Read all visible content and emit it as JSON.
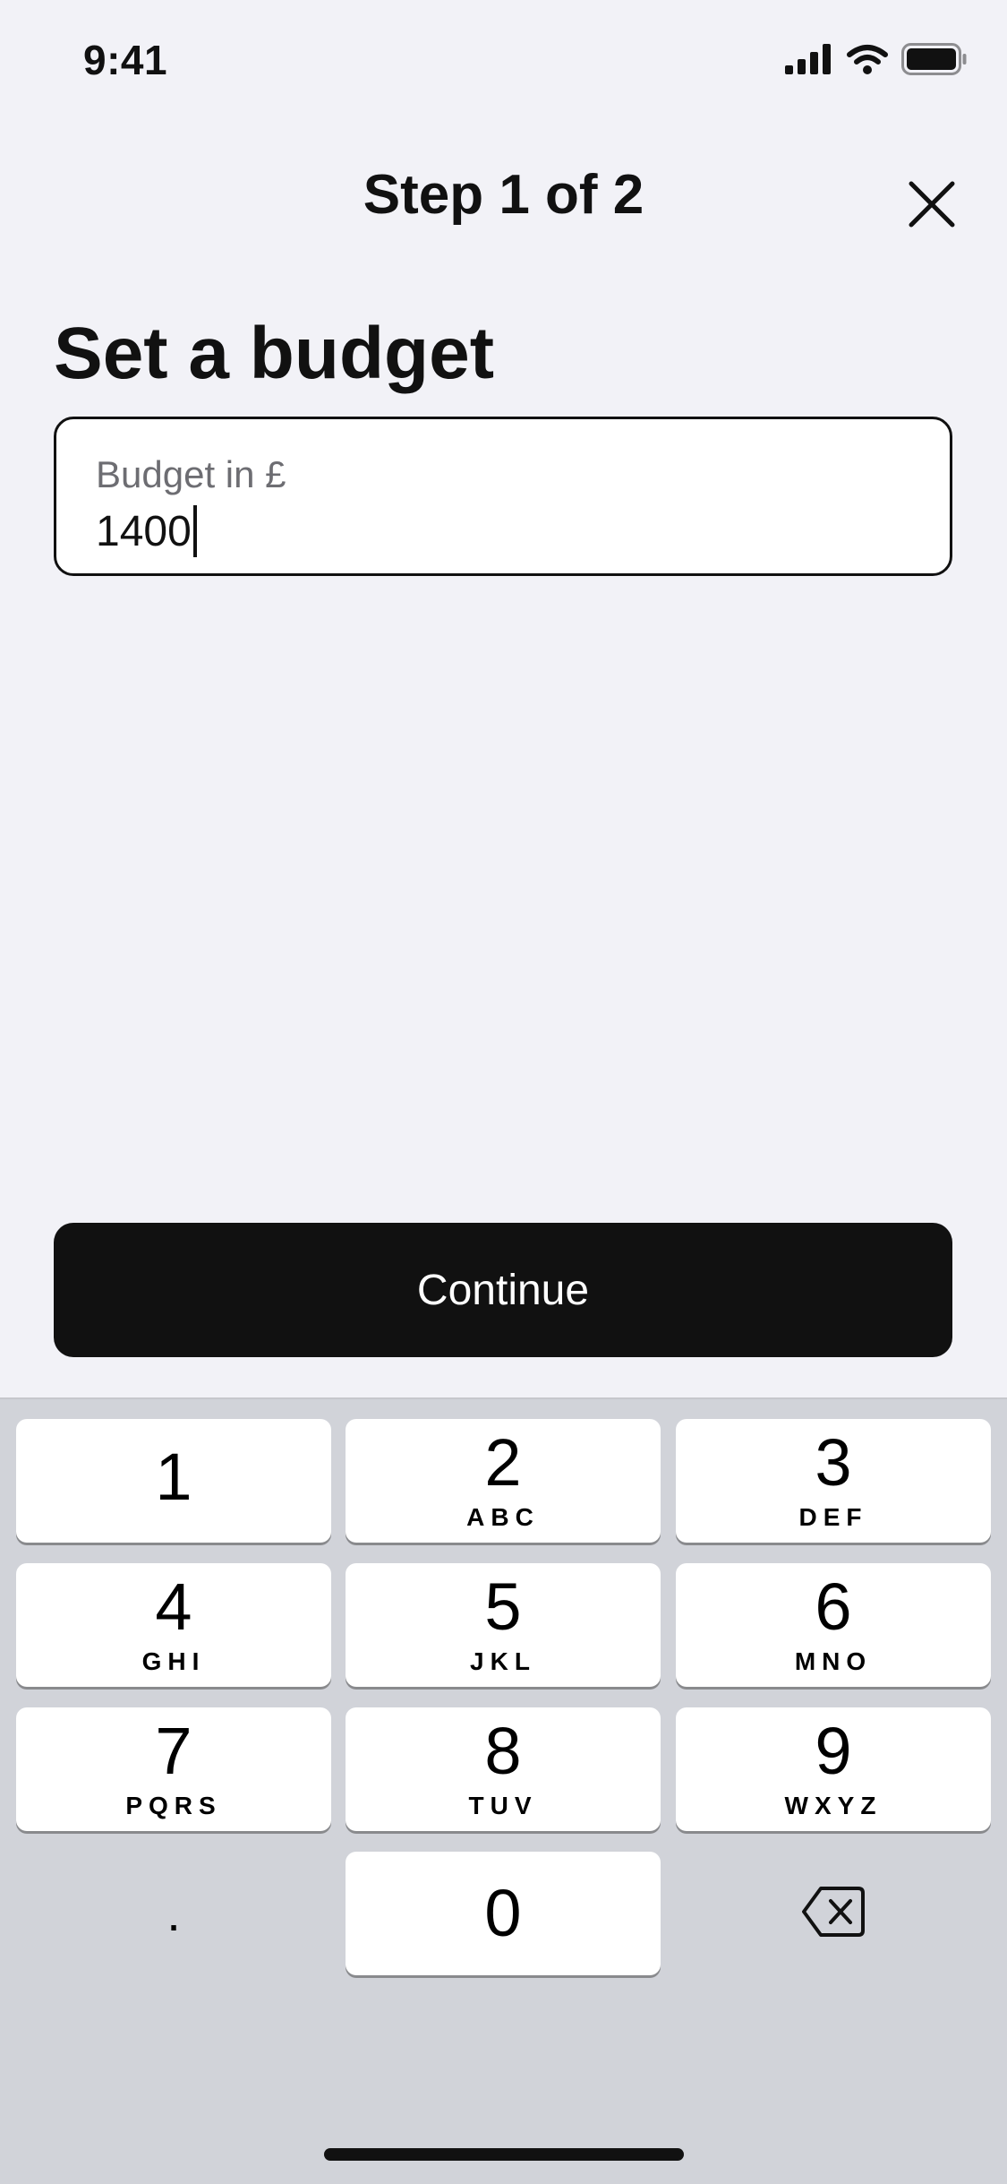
{
  "status_bar": {
    "time": "9:41",
    "icons": [
      "cellular-signal-icon",
      "wifi-icon",
      "battery-icon"
    ]
  },
  "nav": {
    "title": "Step 1 of 2",
    "close_icon": "close-icon"
  },
  "page": {
    "title": "Set a budget"
  },
  "budget_field": {
    "label": "Budget in £",
    "value": "1400"
  },
  "continue_button": {
    "label": "Continue"
  },
  "keypad": {
    "keys": [
      {
        "digit": "1",
        "letters": ""
      },
      {
        "digit": "2",
        "letters": "ABC"
      },
      {
        "digit": "3",
        "letters": "DEF"
      },
      {
        "digit": "4",
        "letters": "GHI"
      },
      {
        "digit": "5",
        "letters": "JKL"
      },
      {
        "digit": "6",
        "letters": "MNO"
      },
      {
        "digit": "7",
        "letters": "PQRS"
      },
      {
        "digit": "8",
        "letters": "TUV"
      },
      {
        "digit": "9",
        "letters": "WXYZ"
      }
    ],
    "decimal": ".",
    "zero": "0",
    "delete_icon": "backspace-icon"
  },
  "colors": {
    "background": "#f2f2f7",
    "primary": "#111111",
    "keyboard_bg": "#d1d3d9",
    "key_bg": "#ffffff"
  }
}
